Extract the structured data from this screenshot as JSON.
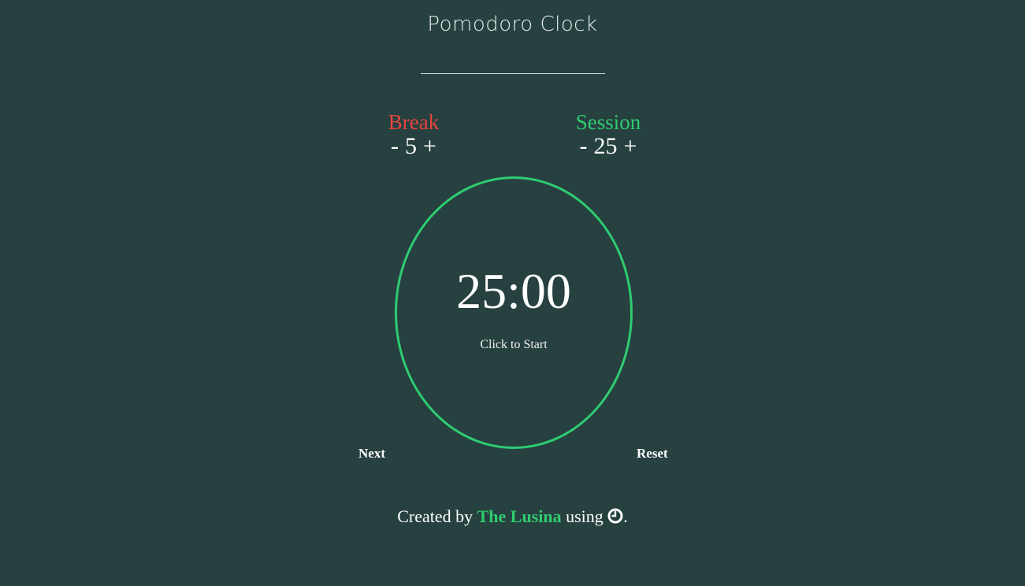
{
  "header": {
    "title": "Pomodoro Clock"
  },
  "break": {
    "label": "Break",
    "decrement": "-",
    "value": "5",
    "increment": "+"
  },
  "session": {
    "label": "Session",
    "decrement": "-",
    "value": "25",
    "increment": "+"
  },
  "timer": {
    "time": "25:00",
    "hint": "Click to Start"
  },
  "actions": {
    "next": "Next",
    "reset": "Reset"
  },
  "footer": {
    "prefix": "Created by",
    "author": "The Lusina",
    "middle": "using",
    "suffix": ".",
    "icon": "clock-icon"
  },
  "colors": {
    "background": "#274040",
    "break": "#e8453c",
    "session": "#2ecc71",
    "text": "#ffffff"
  }
}
